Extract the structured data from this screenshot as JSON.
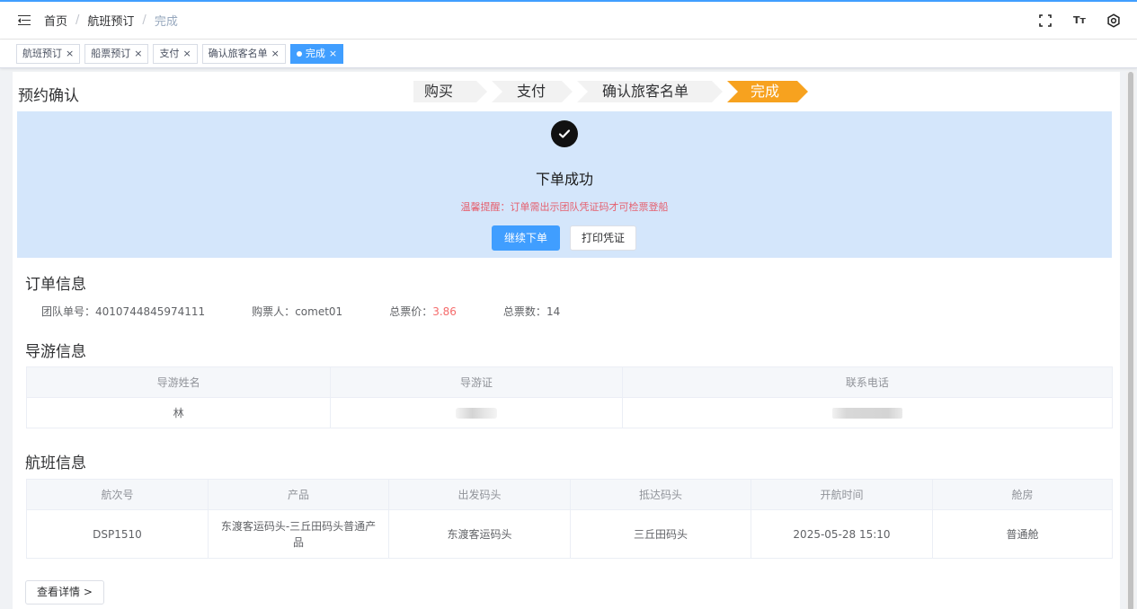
{
  "header": {
    "breadcrumb": [
      "首页",
      "航班预订",
      "完成"
    ],
    "icons": [
      "fullscreen-icon",
      "font-size-icon",
      "settings-icon"
    ],
    "font_icon_text": "Tт"
  },
  "tags": [
    {
      "label": "航班预订",
      "active": false
    },
    {
      "label": "船票预订",
      "active": false
    },
    {
      "label": "支付",
      "active": false
    },
    {
      "label": "确认旅客名单",
      "active": false
    },
    {
      "label": "完成",
      "active": true
    }
  ],
  "tag_close": "×",
  "page": {
    "title": "预约确认",
    "steps": [
      "购买",
      "支付",
      "确认旅客名单",
      "完成"
    ],
    "active_step": "完成",
    "accent_color": "#f7a21f",
    "primary_color": "#409eff"
  },
  "banner": {
    "title": "下单成功",
    "tip": "温馨提醒：订单需出示团队凭证码才可检票登船",
    "continue_label": "继续下单",
    "print_label": "打印凭证"
  },
  "order": {
    "section_title": "订单信息",
    "group_no_label": "团队单号：",
    "group_no": "4010744845974111",
    "buyer_label": "购票人：",
    "buyer": "comet01",
    "price_label": "总票价：",
    "price": "3.86",
    "count_label": "总票数：",
    "count": "14"
  },
  "guide": {
    "section_title": "导游信息",
    "headers": [
      "导游姓名",
      "导游证",
      "联系电话"
    ],
    "row": {
      "name": "林",
      "cert": "",
      "phone": ""
    }
  },
  "flight": {
    "section_title": "航班信息",
    "headers": [
      "航次号",
      "产品",
      "出发码头",
      "抵达码头",
      "开航时间",
      "舱房"
    ],
    "row": {
      "voyage": "DSP1510",
      "product": "东渡客运码头-三丘田码头普通产品",
      "depart": "东渡客运码头",
      "arrive": "三丘田码头",
      "time": "2025-05-28 15:10",
      "cabin": "普通舱"
    }
  },
  "detail_button": "查看详情 >"
}
